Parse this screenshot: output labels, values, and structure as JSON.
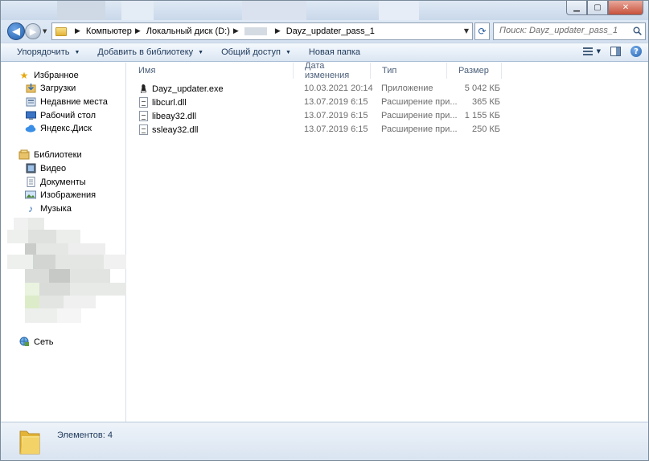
{
  "address": {
    "crumbs": [
      "Компьютер",
      "Локальный диск (D:)",
      "Dayz_updater_pass_1"
    ]
  },
  "search": {
    "placeholder": "Поиск: Dayz_updater_pass_1"
  },
  "toolbar": {
    "organize": "Упорядочить",
    "add_to_library": "Добавить в библиотеку",
    "share": "Общий доступ",
    "new_folder": "Новая папка"
  },
  "sidebar": {
    "favorites": "Избранное",
    "downloads": "Загрузки",
    "recent": "Недавние места",
    "desktop": "Рабочий стол",
    "yandex_disk": "Яндекс.Диск",
    "libraries": "Библиотеки",
    "video": "Видео",
    "documents": "Документы",
    "images": "Изображения",
    "music": "Музыка",
    "network": "Сеть"
  },
  "columns": {
    "name": "Имя",
    "date": "Дата изменения",
    "type": "Тип",
    "size": "Размер"
  },
  "files": [
    {
      "name": "Dayz_updater.exe",
      "date": "10.03.2021 20:14",
      "type": "Приложение",
      "size": "5 042 КБ",
      "icon": "exe-icon"
    },
    {
      "name": "libcurl.dll",
      "date": "13.07.2019 6:15",
      "type": "Расширение при...",
      "size": "365 КБ",
      "icon": "dll-icon"
    },
    {
      "name": "libeay32.dll",
      "date": "13.07.2019 6:15",
      "type": "Расширение при...",
      "size": "1 155 КБ",
      "icon": "dll-icon"
    },
    {
      "name": "ssleay32.dll",
      "date": "13.07.2019 6:15",
      "type": "Расширение при...",
      "size": "250 КБ",
      "icon": "dll-icon"
    }
  ],
  "status": {
    "items_count": "Элементов: 4"
  },
  "colors": {
    "accent": "#1e395b",
    "muted": "#6d6d6d",
    "header_text": "#4c607a"
  }
}
